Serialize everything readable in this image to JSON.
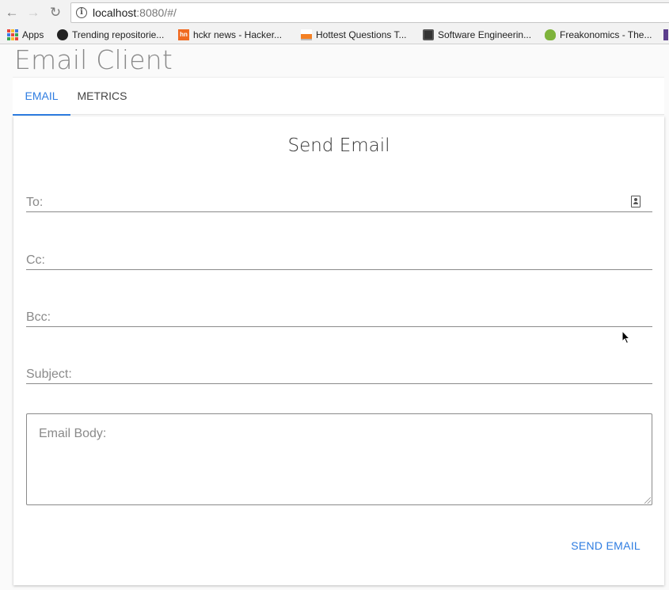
{
  "browser": {
    "url_host": "localhost",
    "url_rest": ":8080/#/",
    "bookmarks": [
      {
        "label": "Apps",
        "icon": "apps-grid-icon"
      },
      {
        "label": "Trending repositorie...",
        "icon": "github-icon"
      },
      {
        "label": "hckr news - Hacker...",
        "icon": "hn-icon"
      },
      {
        "label": "Hottest Questions T...",
        "icon": "stackoverflow-icon"
      },
      {
        "label": "Software Engineerin...",
        "icon": "laptop-icon"
      },
      {
        "label": "Freakonomics - The...",
        "icon": "freakonomics-icon"
      }
    ]
  },
  "app": {
    "title": "Email Client",
    "tabs": [
      {
        "label": "EMAIL",
        "active": true
      },
      {
        "label": "METRICS",
        "active": false
      }
    ],
    "form": {
      "title": "Send Email",
      "to_placeholder": "To:",
      "cc_placeholder": "Cc:",
      "bcc_placeholder": "Bcc:",
      "subject_placeholder": "Subject:",
      "body_placeholder": "Email Body:",
      "send_label": "SEND EMAIL"
    }
  },
  "colors": {
    "accent": "#2f7de1",
    "title_gray": "#8a8a8a"
  }
}
